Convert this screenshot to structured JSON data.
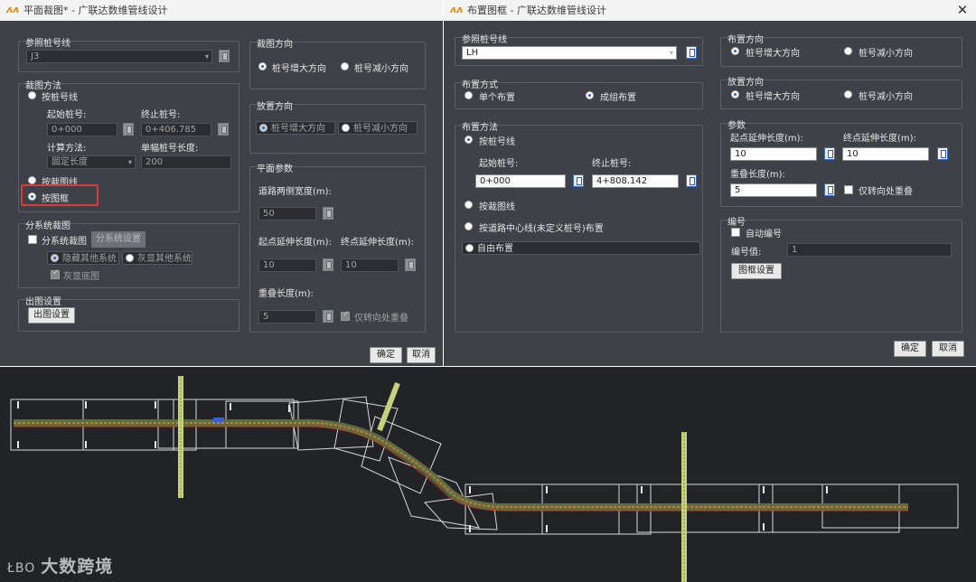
{
  "left_dialog": {
    "title": "平面裁图* - 广联达数维管线设计",
    "ref_group": "参照桩号线",
    "ref_value": "J3",
    "method_group": "裁图方法",
    "by_stake_line": "按桩号线",
    "start_stake_label": "起始桩号:",
    "end_stake_label": "终止桩号:",
    "start_stake_value": "0+000",
    "end_stake_value": "0+406.785",
    "calc_method_label": "计算方法:",
    "single_length_label": "单幅桩号长度:",
    "calc_method_value": "固定长度",
    "single_length_value": "200",
    "by_cut_line": "按裁图线",
    "by_frame": "按图框",
    "subsys_group": "分系统裁图",
    "subsys_check": "分系统裁图",
    "subsys_settings": "分系统设置",
    "hide_other": "隐藏其他系统",
    "gray_other": "灰显其他系统",
    "gray_base": "灰显底图",
    "output_group": "出图设置",
    "output_button": "出图设置",
    "direction_group": "裁图方向",
    "dir_increase": "桩号增大方向",
    "dir_decrease": "桩号减小方向",
    "place_group": "放置方向",
    "place_increase": "桩号增大方向",
    "place_decrease": "桩号减小方向",
    "params_group": "平面参数",
    "road_width_label": "道路两侧宽度(m):",
    "road_width_value": "50",
    "start_ext_label": "起点延伸长度(m):",
    "end_ext_label": "终点延伸长度(m):",
    "start_ext_value": "10",
    "end_ext_value": "10",
    "overlap_label": "重叠长度(m):",
    "overlap_value": "5",
    "turn_only": "仅转向处重叠",
    "ok": "确定",
    "cancel": "取消"
  },
  "right_dialog": {
    "title": "布置图框 - 广联达数维管线设计",
    "ref_group": "参照桩号线",
    "ref_value": "LH",
    "layout_group": "布置方式",
    "single": "单个布置",
    "group_layout": "成组布置",
    "method_group": "布置方法",
    "by_stake_line": "按桩号线",
    "start_stake_label": "起始桩号:",
    "end_stake_label": "终止桩号:",
    "start_stake_value": "0+000",
    "end_stake_value": "4+808.142",
    "by_cut_line": "按裁图线",
    "by_center_line": "按道路中心线(未定义桩号)布置",
    "free_layout": "自由布置",
    "direction_group": "布置方向",
    "dir_increase": "桩号增大方向",
    "dir_decrease": "桩号减小方向",
    "place_group": "放置方向",
    "place_increase": "桩号增大方向",
    "place_decrease": "桩号减小方向",
    "params_group": "参数",
    "start_ext_label": "起点延伸长度(m):",
    "end_ext_label": "终点延伸长度(m):",
    "start_ext_value": "10",
    "end_ext_value": "10",
    "overlap_label": "重叠长度(m):",
    "overlap_value": "5",
    "turn_only": "仅转向处重叠",
    "number_group": "编号",
    "auto_number": "自动编号",
    "number_value_label": "编号值:",
    "number_value": "1",
    "frame_settings": "图框设置",
    "ok": "确定",
    "cancel": "取消"
  },
  "watermark": {
    "icon_text": "ŁBO",
    "text": "大数跨境"
  },
  "colors": {
    "dialog_bg": "#3e4148",
    "cad_bg": "#222327",
    "highlight": "#d93a3a",
    "radio_selected": "#2260d0"
  }
}
